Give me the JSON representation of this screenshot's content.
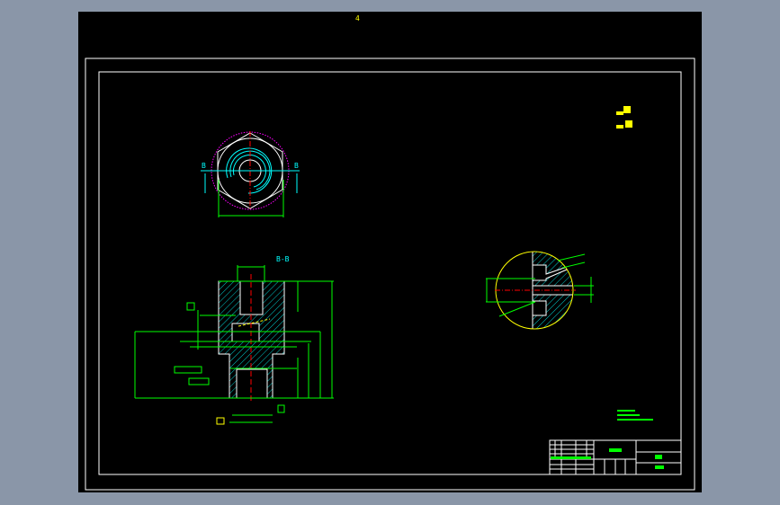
{
  "viewer": {
    "layout_tab_marker": "4",
    "background_color": "#000000",
    "frame_color": "#ffffff"
  },
  "drawing": {
    "top_view": {
      "section_mark_left": "B",
      "section_mark_right": "B"
    },
    "section_view": {
      "title": "B-B"
    },
    "colors": {
      "outline": "#ffffff",
      "dimension": "#00ff00",
      "hatch": "#00ffff",
      "centerline": "#ff0000",
      "detail_circle": "#ffff00",
      "pitch_circle": "#ff00ff"
    }
  }
}
